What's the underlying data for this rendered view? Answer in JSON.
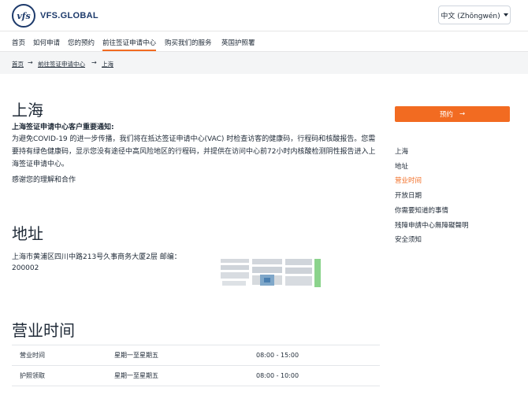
{
  "header": {
    "logo_mark": "vfs",
    "logo_text": "VFS.GLOBAL",
    "language_label": "中文 (Zhōngwén)"
  },
  "nav": {
    "items": [
      "首页",
      "如何申请",
      "您的预约",
      "前往签证申请中心",
      "购买我们的服务",
      "英国护照署"
    ],
    "active_index": 3
  },
  "breadcrumb": {
    "items": [
      "首页",
      "前往签证申请中心",
      "上海"
    ],
    "separator": "→"
  },
  "main": {
    "title": "上海",
    "notice_title": "上海签证申请中心客户重要通知:",
    "notice_body": "为避免COVID-19 的进一步传播，我们将在抵达签证申请中心(VAC) 时检查访客的健康码，行程码和核酸报告。您需要持有绿色健康码，显示您没有途径中高风险地区的行程码，并提供在访问中心前72小时内核酸检测阴性报告进入上海签证申请中心。",
    "thanks": "感谢您的理解和合作",
    "address_heading": "地址",
    "address_text": "上海市黄浦区四川中路213号久事商务大厦2层 邮编：200002",
    "hours_heading": "营业时间",
    "hours_rows": [
      {
        "label": "营业时间",
        "days": "星期一至星期五",
        "time": "08:00 - 15:00"
      },
      {
        "label": "护照领取",
        "days": "星期一至星期五",
        "time": "08:00 - 10:00"
      }
    ]
  },
  "sidebar": {
    "book_label": "预约",
    "book_arrow": "→",
    "links": [
      "上海",
      "地址",
      "营业时间",
      "开放日期",
      "你需要知道的事情",
      "残障申請中心無障礙聲明",
      "安全须知"
    ],
    "active_index": 2
  },
  "colors": {
    "accent": "#f26b21",
    "brand": "#1d3a6b",
    "text": "#1f2a37"
  }
}
